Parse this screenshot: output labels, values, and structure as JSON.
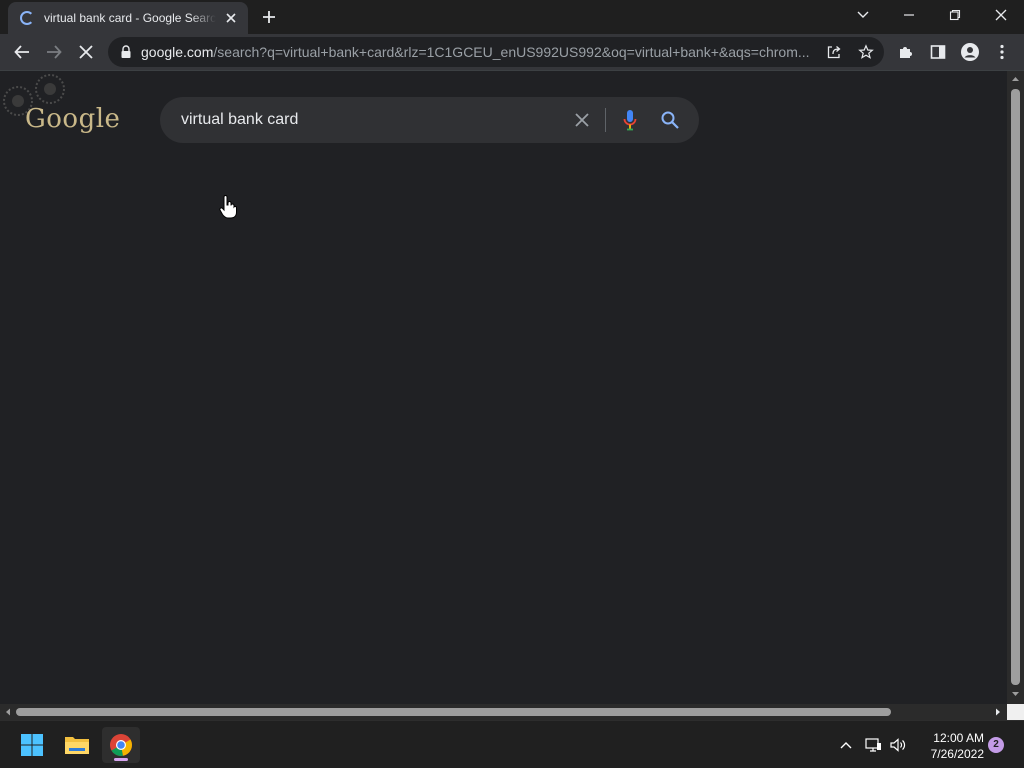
{
  "browser": {
    "tab": {
      "title": "virtual bank card - Google Search"
    },
    "url": {
      "host": "google.com",
      "rest": "/search?q=virtual+bank+card&rlz=1C1GCEU_enUS992US992&oq=virtual+bank+&aqs=chrom..."
    }
  },
  "page": {
    "logo_text": "Google",
    "search": {
      "query": "virtual bank card"
    }
  },
  "taskbar": {
    "time": "12:00 AM",
    "date": "7/26/2022",
    "notification_count": "2"
  },
  "colors": {
    "page_background": "#202124",
    "search_box": "#303134",
    "accent_blue": "#8ab4f8"
  },
  "icons": {
    "tab_loading": "spinner-icon",
    "close": "close-icon",
    "new_tab": "plus-icon",
    "back": "back-arrow-icon",
    "forward": "forward-arrow-icon",
    "stop": "stop-x-icon",
    "lock": "lock-icon",
    "share": "share-icon",
    "bookmark": "star-icon",
    "extensions": "puzzle-icon",
    "side_panel": "side-panel-icon",
    "profile": "profile-icon",
    "menu": "kebab-menu-icon",
    "mic": "microphone-icon",
    "search": "search-icon"
  }
}
